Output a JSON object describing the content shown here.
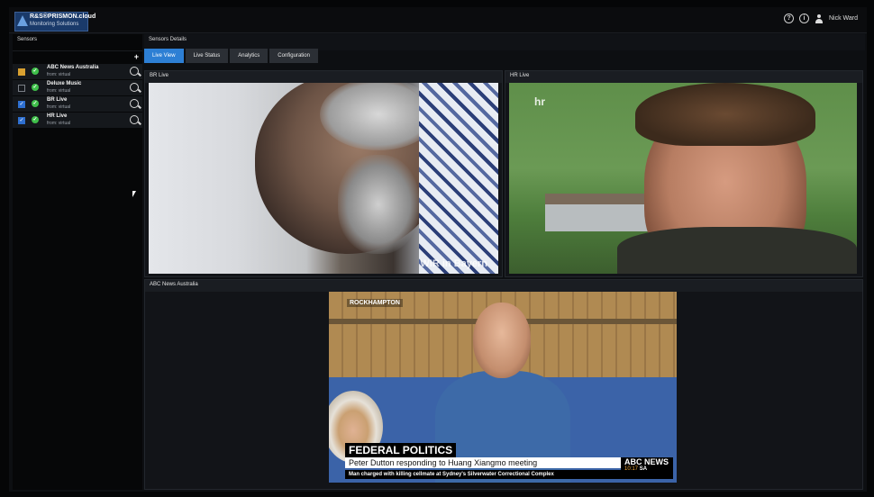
{
  "app": {
    "logo_line1": "R&S®PRISMON.cloud",
    "logo_line2": "Monitoring Solutions",
    "user_name": "Nick Ward",
    "help_icon": "?",
    "info_icon": "i"
  },
  "sidebar": {
    "title": "Sensors",
    "add_label": "+",
    "sensors": [
      {
        "name": "ABC News Australia",
        "sub": "from: virtual",
        "check": "partial",
        "status": "ok"
      },
      {
        "name": "Deluxe Music",
        "sub": "from: virtual",
        "check": "unchecked",
        "status": "ok"
      },
      {
        "name": "BR Live",
        "sub": "from: virtual",
        "check": "checked",
        "status": "ok"
      },
      {
        "name": "HR Live",
        "sub": "from: virtual",
        "check": "checked",
        "status": "ok"
      }
    ]
  },
  "main": {
    "title": "Sensors Details",
    "tabs": [
      "Live View",
      "Live Status",
      "Analytics",
      "Configuration"
    ],
    "active_tab": "Live View",
    "panels": {
      "br": {
        "title": "BR Live",
        "logo": "WIR in Bayern"
      },
      "hr": {
        "title": "HR Live",
        "logo": "hr"
      },
      "abc": {
        "title": "ABC News Australia",
        "location": "ROCKHAMPTON",
        "kicker": "FEDERAL POLITICS",
        "headline": "Peter Dutton responding to Huang Xiangmo meeting",
        "ticker": "Man charged with killing cellmate at Sydney's Silverwater Correctional Complex",
        "brand": "ABC NEWS",
        "time": "10:17",
        "region": "SA"
      }
    }
  },
  "colors": {
    "accent": "#2d7fd4",
    "ok": "#3fbf4a",
    "partial": "#d8a030"
  }
}
